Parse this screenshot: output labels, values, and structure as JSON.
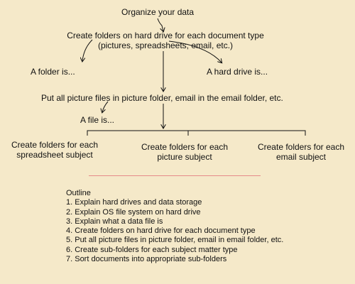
{
  "diagram": {
    "root": "Organize your data",
    "step_folders": {
      "line1": "Create folders on hard drive for each document type",
      "line2": "(pictures, spreadsheets, email, etc.)"
    },
    "folder_is": "A folder is...",
    "hard_drive_is": "A hard drive is...",
    "step_files": "Put all picture files in picture folder, email in the email folder, etc.",
    "file_is": "A file is...",
    "sub_spreadsheet": {
      "line1": "Create folders for each",
      "line2": "spreadsheet subject"
    },
    "sub_picture": {
      "line1": "Create folders for each",
      "line2": "picture subject"
    },
    "sub_email": {
      "line1": "Create folders for each",
      "line2": "email subject"
    }
  },
  "outline": {
    "heading": "Outline",
    "items": [
      "1. Explain hard drives and data storage",
      "2. Explain OS file system on hard drive",
      "3. Explain what a data file is",
      "4. Create folders on hard drive for each document type",
      "5. Put all picture files in picture folder, email in email folder, etc.",
      "6. Create sub-folders for each subject matter type",
      "7. Sort documents into appropriate sub-folders"
    ]
  },
  "colors": {
    "background": "#f5e9c9",
    "ink": "#111111",
    "divider": "#e58a8a"
  }
}
